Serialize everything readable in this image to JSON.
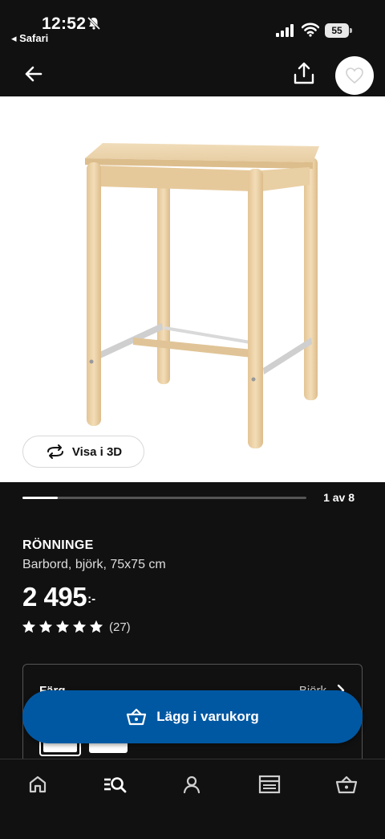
{
  "status_bar": {
    "time": "12:52",
    "back_app": "◂ Safari",
    "battery": "55"
  },
  "gallery": {
    "view3d_label": "Visa i 3D",
    "current": 1,
    "total": 8,
    "pager_label": "1 av 8",
    "progress_fraction": 0.125
  },
  "product": {
    "name": "RÖNNINGE",
    "description": "Barbord, björk, 75x75 cm",
    "price": "2 495",
    "price_suffix": ":-",
    "rating_value": 5,
    "rating_count": "(27)"
  },
  "options": {
    "label": "Färg",
    "value": "Björk"
  },
  "cart": {
    "button_label": "Lägg i varukorg"
  },
  "tabs": [
    {
      "name": "home-icon"
    },
    {
      "name": "search-icon"
    },
    {
      "name": "profile-icon"
    },
    {
      "name": "store-icon"
    },
    {
      "name": "basket-icon"
    }
  ],
  "colors": {
    "background": "#111111",
    "accent_blue": "#0058a3",
    "wood": "#ecd3ab"
  }
}
